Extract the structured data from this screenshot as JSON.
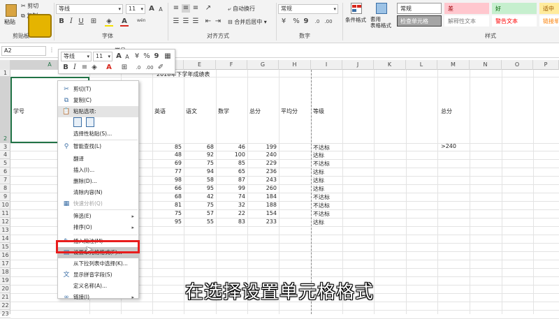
{
  "ribbon": {
    "clipboard": {
      "paste": "粘贴",
      "cut": "剪切",
      "copy": "复制",
      "label": "剪贴板"
    },
    "font": {
      "name": "等线",
      "size": "11",
      "label": "字体",
      "grow": "A",
      "shrink": "A",
      "bold": "B",
      "italic": "I",
      "underline": "U",
      "phonetic": "wén",
      "font_color": "#d7271d",
      "fill_color": "#f5e000"
    },
    "alignment": {
      "wrap": "自动换行",
      "merge": "合并后居中",
      "label": "对齐方式"
    },
    "number": {
      "format": "常规",
      "label": "数字",
      "percent": "%",
      "comma": "9"
    },
    "styles": {
      "cond_fmt": "条件格式",
      "table_fmt": "套用\n表格格式",
      "label": "样式",
      "cells": [
        {
          "text": "常规",
          "bg": "#ffffff",
          "color": "#222",
          "border": "#999"
        },
        {
          "text": "差",
          "bg": "#ffc7ce",
          "color": "#9c0006",
          "border": "#ffc7ce"
        },
        {
          "text": "好",
          "bg": "#c6efce",
          "color": "#006100",
          "border": "#c6efce"
        },
        {
          "text": "适中",
          "bg": "#ffeb9c",
          "color": "#9c5700",
          "border": "#ffeb9c"
        },
        {
          "text": "检查单元格",
          "bg": "#a5a5a5",
          "color": "#ffffff",
          "border": "#3f3f3f"
        },
        {
          "text": "解释性文本",
          "bg": "#ffffff",
          "color": "#7f7f7f",
          "border": "#ffffff"
        },
        {
          "text": "警告文本",
          "bg": "#ffffff",
          "color": "#ff0000",
          "border": "#ffffff"
        },
        {
          "text": "链接单",
          "bg": "#ffffff",
          "color": "#fa7d00",
          "border": "#ffffff"
        }
      ]
    }
  },
  "formula_bar": {
    "name_box": "A2",
    "content": "学号"
  },
  "mini_toolbar": {
    "font": "等线",
    "size": "11",
    "bold": "B",
    "italic": "I",
    "percent": "%",
    "comma": "9"
  },
  "columns": [
    "A",
    "B",
    "C",
    "D",
    "E",
    "F",
    "G",
    "H",
    "I",
    "J",
    "K",
    "L",
    "M",
    "N",
    "O",
    "P"
  ],
  "rows": [
    "1",
    "2",
    "3",
    "4",
    "5",
    "6",
    "7",
    "8",
    "9",
    "10",
    "11",
    "12",
    "13",
    "14",
    "15",
    "16",
    "17",
    "18",
    "19",
    "20",
    "21",
    "22",
    "23"
  ],
  "sheet": {
    "title": "2018年下学年成绩表",
    "headers": {
      "a": "学号",
      "e": "英语",
      "f": "语文",
      "g": "数学",
      "gg": "总分",
      "h": "平均分",
      "i": "等级",
      "m": "总分"
    },
    "m3": ">240",
    "data": [
      {
        "e": "85",
        "f": "68",
        "g": "46",
        "t": "199",
        "grade": "不达标"
      },
      {
        "e": "48",
        "f": "92",
        "g": "100",
        "t": "240",
        "grade": "达标"
      },
      {
        "e": "69",
        "f": "75",
        "g": "85",
        "t": "229",
        "grade": "不达标"
      },
      {
        "e": "77",
        "f": "94",
        "g": "65",
        "t": "236",
        "grade": "达标"
      },
      {
        "e": "98",
        "f": "58",
        "g": "87",
        "t": "243",
        "grade": "达标"
      },
      {
        "e": "66",
        "f": "95",
        "g": "99",
        "t": "260",
        "grade": "达标"
      },
      {
        "e": "68",
        "f": "42",
        "g": "74",
        "t": "184",
        "grade": "不达标"
      },
      {
        "e": "81",
        "f": "75",
        "g": "32",
        "t": "188",
        "grade": "不达标"
      },
      {
        "e": "75",
        "f": "57",
        "g": "22",
        "t": "154",
        "grade": "不达标"
      },
      {
        "e": "95",
        "f": "55",
        "g": "83",
        "t": "233",
        "grade": "达标"
      }
    ]
  },
  "context_menu": {
    "items": [
      {
        "label": "剪切(T)",
        "icon": "cut-icon",
        "glyph": "✂"
      },
      {
        "label": "复制(C)",
        "icon": "copy-icon",
        "glyph": "⧉"
      },
      {
        "label": "粘贴选项:",
        "icon": "paste-icon",
        "glyph": "📋"
      },
      {
        "label": "选择性粘贴(S)...",
        "icon": "",
        "glyph": ""
      },
      {
        "label": "智能查找(L)",
        "icon": "search-icon",
        "glyph": "⚲"
      },
      {
        "label": "翻译",
        "icon": "",
        "glyph": ""
      },
      {
        "label": "插入(I)...",
        "icon": "",
        "glyph": ""
      },
      {
        "label": "删除(D)...",
        "icon": "",
        "glyph": ""
      },
      {
        "label": "清除内容(N)",
        "icon": "",
        "glyph": ""
      },
      {
        "label": "快速分析(Q)",
        "icon": "quick-analysis-icon",
        "glyph": "▦"
      },
      {
        "label": "筛选(E)",
        "icon": "",
        "glyph": ""
      },
      {
        "label": "排序(O)",
        "icon": "",
        "glyph": ""
      },
      {
        "label": "插入批注(M)",
        "icon": "comment-icon",
        "glyph": "✎"
      },
      {
        "label": "设置单元格格式(F)...",
        "icon": "format-cells-icon",
        "glyph": "▤"
      },
      {
        "label": "从下拉列表中选择(K)...",
        "icon": "",
        "glyph": ""
      },
      {
        "label": "显示拼音字段(S)",
        "icon": "phonetic-icon",
        "glyph": "文"
      },
      {
        "label": "定义名称(A)...",
        "icon": "",
        "glyph": ""
      },
      {
        "label": "链接(I)",
        "icon": "link-icon",
        "glyph": "∞"
      }
    ],
    "highlight_color": "#e81c1c"
  },
  "subtitle": "在选择设置单元格格式"
}
